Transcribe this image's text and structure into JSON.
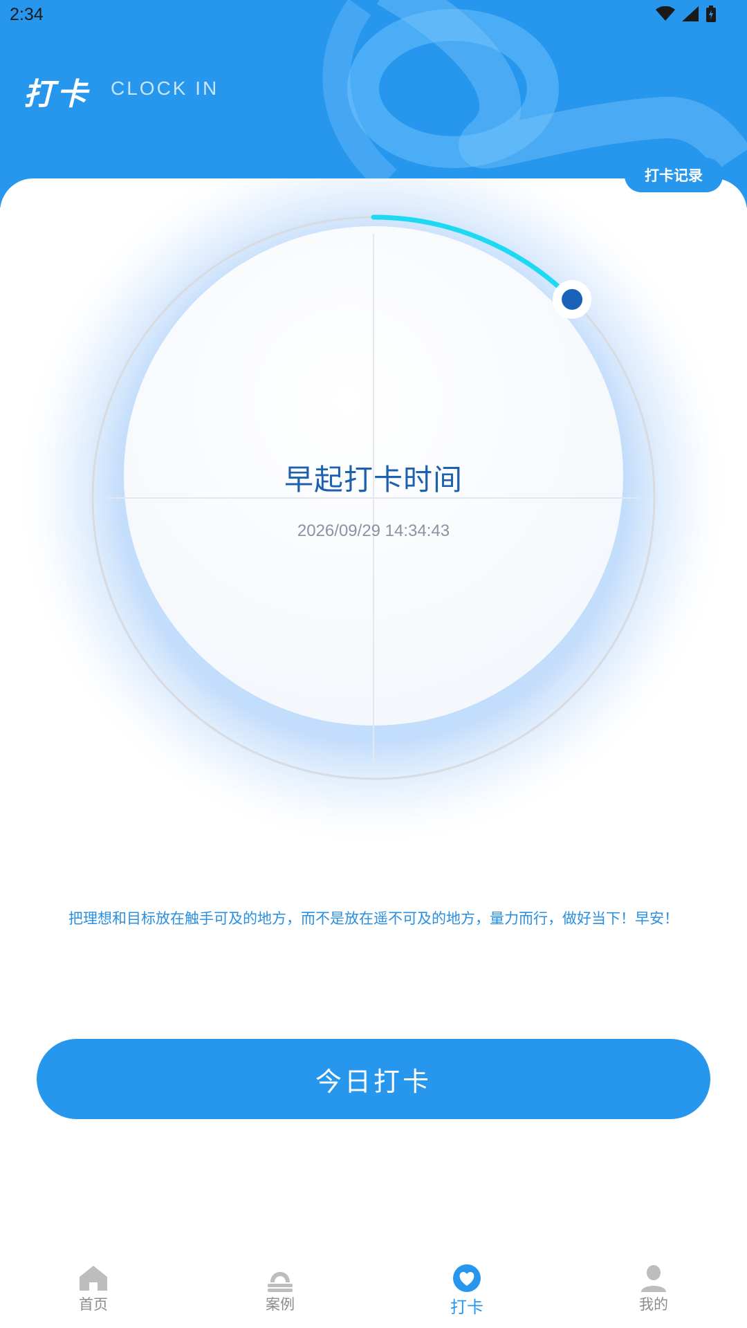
{
  "status_bar": {
    "time": "2:34",
    "icons": [
      "wifi-icon",
      "signal-icon",
      "battery-icon"
    ]
  },
  "header": {
    "title": "打卡",
    "subtitle": "CLOCK IN",
    "record_button": "打卡记录"
  },
  "dial": {
    "title": "早起打卡时间",
    "datetime": "2026/09/29 14:34:43",
    "progress_fraction": 0.125
  },
  "motto": "把理想和目标放在触手可及的地方，而不是放在遥不可及的地方，量力而行，做好当下！早安！",
  "clock_in_button": "今日打卡",
  "tabbar": {
    "tabs": [
      {
        "label": "首页",
        "icon": "home-icon",
        "active": false
      },
      {
        "label": "案例",
        "icon": "case-icon",
        "active": false
      },
      {
        "label": "打卡",
        "icon": "heart-icon",
        "active": true
      },
      {
        "label": "我的",
        "icon": "user-icon",
        "active": false
      }
    ]
  },
  "colors": {
    "primary": "#2797ee",
    "progress": "#1fd8f2",
    "knob": "#1a62b8",
    "title": "#1c60b0"
  }
}
